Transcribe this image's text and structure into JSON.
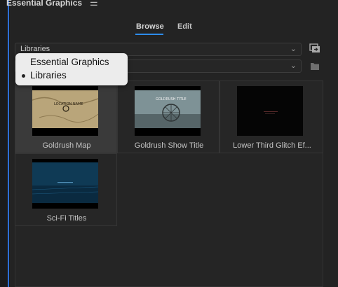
{
  "panel": {
    "title": "Essential Graphics",
    "menu_icon": "hamburger-menu-icon"
  },
  "tabs": [
    {
      "label": "Browse",
      "active": true
    },
    {
      "label": "Edit",
      "active": false
    }
  ],
  "library_dropdown": {
    "value": "Libraries"
  },
  "secondary_dropdown": {
    "value": ""
  },
  "icons": {
    "import": "import-template-icon",
    "folder": "folder-icon"
  },
  "popup_menu": {
    "options": [
      {
        "label": "Essential Graphics",
        "selected": false
      },
      {
        "label": "Libraries",
        "selected": true
      }
    ]
  },
  "templates": [
    {
      "label": "Goldrush Map",
      "selected": true,
      "thumb_text": "LOCATION NAME"
    },
    {
      "label": "Goldrush Show Title",
      "selected": false,
      "thumb_text": "GOLDRUSH TITLE"
    },
    {
      "label": "Lower Third Glitch Ef...",
      "selected": false,
      "thumb_text": ""
    },
    {
      "label": "Sci-Fi Titles",
      "selected": false,
      "thumb_text": ""
    }
  ],
  "colors": {
    "accent": "#2d8ceb",
    "panel_bg": "#232323"
  }
}
